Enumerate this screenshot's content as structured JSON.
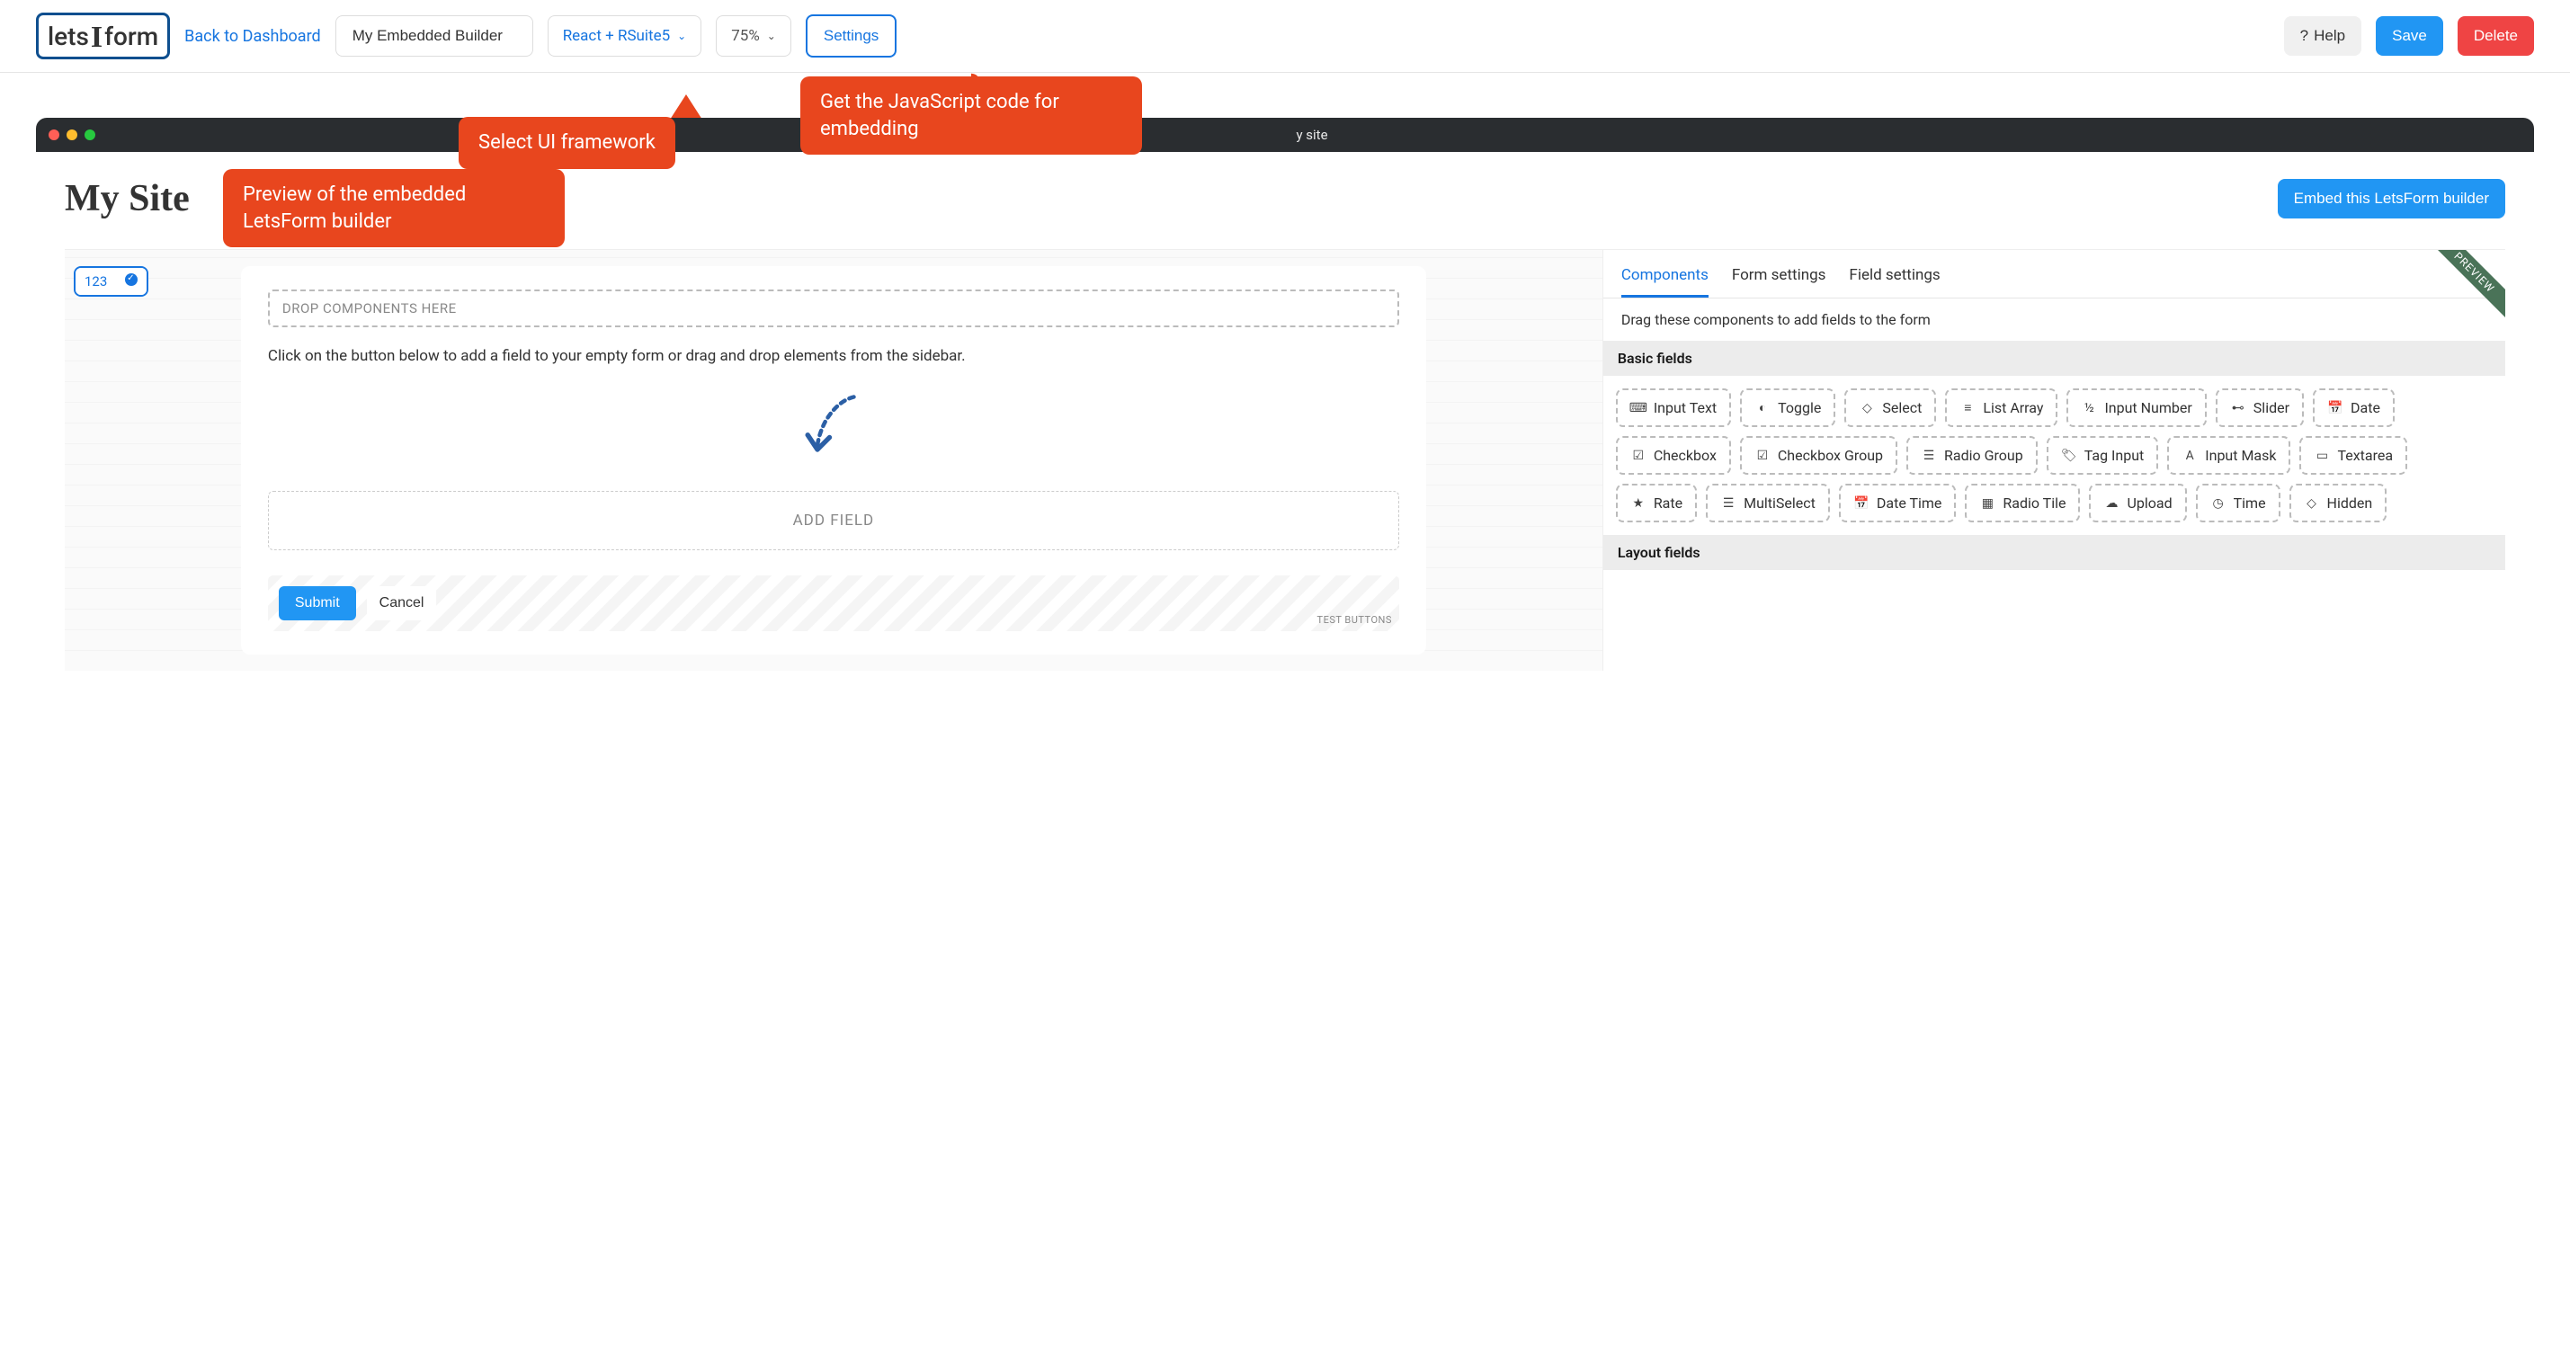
{
  "header": {
    "back_link": "Back to Dashboard",
    "form_name": "My Embedded Builder",
    "framework": "React + RSuite5",
    "zoom": "75%",
    "settings": "Settings",
    "help": "Help",
    "save": "Save",
    "delete": "Delete"
  },
  "callouts": {
    "a": "Get the JavaScript code for embedding",
    "b": "Select UI framework",
    "c": "Preview of the embedded LetsForm builder"
  },
  "browser": {
    "title_fragment": "y site"
  },
  "site": {
    "title": "My Site",
    "embed_button": "Embed this LetsForm builder"
  },
  "canvas": {
    "side_tab": "123",
    "dropzone": "DROP COMPONENTS HERE",
    "hint": "Click on the button below to add a field to your empty form or drag and drop elements from the sidebar.",
    "add_field": "ADD FIELD",
    "submit": "Submit",
    "cancel": "Cancel",
    "test_buttons": "TEST BUTTONS"
  },
  "sidebar": {
    "preview_ribbon": "PREVIEW",
    "tabs": [
      "Components",
      "Form settings",
      "Field settings"
    ],
    "hint": "Drag these components to add fields to the form",
    "sections": {
      "basic": "Basic fields",
      "layout": "Layout fields"
    },
    "fields": [
      {
        "label": "Input Text",
        "icon": "⌨"
      },
      {
        "label": "Toggle",
        "icon": "◐"
      },
      {
        "label": "Select",
        "icon": "◇"
      },
      {
        "label": "List Array",
        "icon": "≡"
      },
      {
        "label": "Input Number",
        "icon": "½"
      },
      {
        "label": "Slider",
        "icon": "⊷"
      },
      {
        "label": "Date",
        "icon": "📅"
      },
      {
        "label": "Checkbox",
        "icon": "☑"
      },
      {
        "label": "Checkbox Group",
        "icon": "☑"
      },
      {
        "label": "Radio Group",
        "icon": "☰"
      },
      {
        "label": "Tag Input",
        "icon": "🏷"
      },
      {
        "label": "Input Mask",
        "icon": "A"
      },
      {
        "label": "Textarea",
        "icon": "▭"
      },
      {
        "label": "Rate",
        "icon": "★"
      },
      {
        "label": "MultiSelect",
        "icon": "☰"
      },
      {
        "label": "Date Time",
        "icon": "📅"
      },
      {
        "label": "Radio Tile",
        "icon": "▦"
      },
      {
        "label": "Upload",
        "icon": "☁"
      },
      {
        "label": "Time",
        "icon": "◷"
      },
      {
        "label": "Hidden",
        "icon": "◇"
      }
    ]
  }
}
